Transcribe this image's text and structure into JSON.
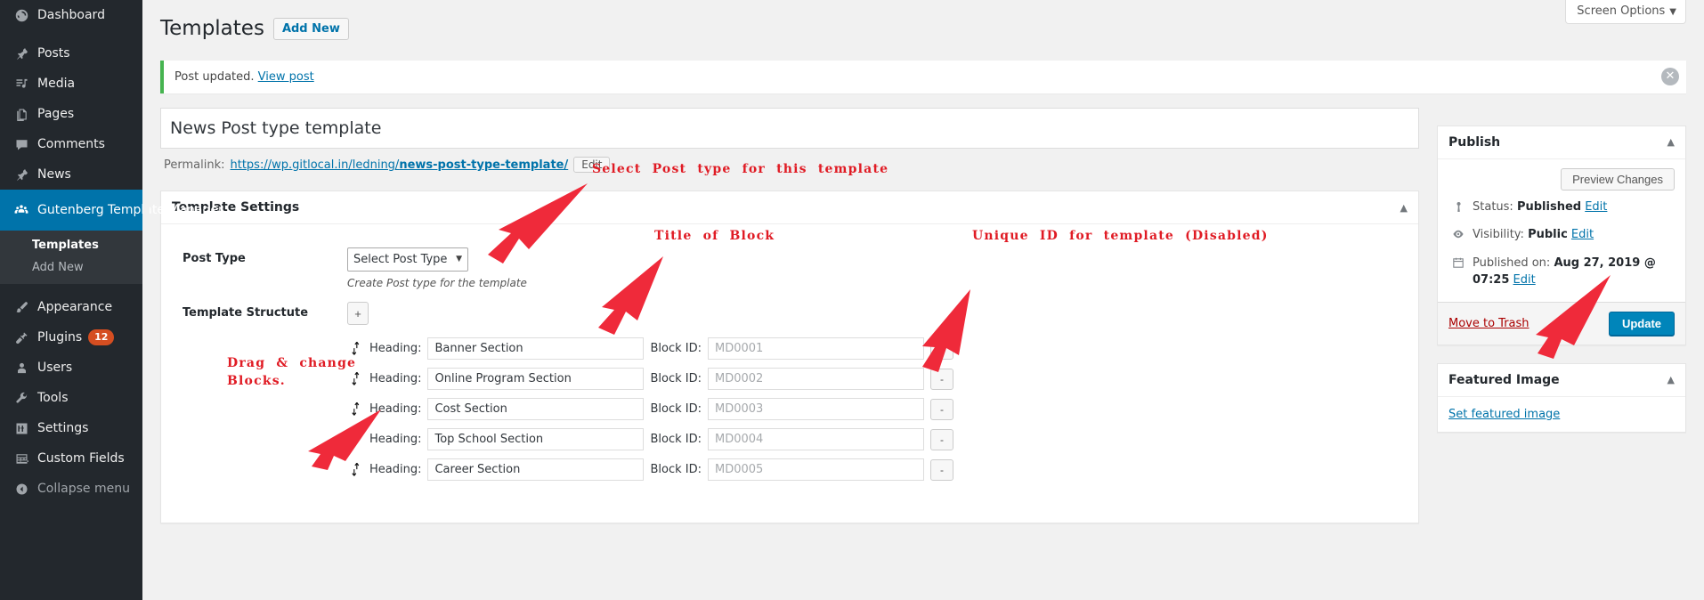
{
  "sidebar": {
    "items": [
      {
        "label": "Dashboard",
        "icon": "dashboard-icon",
        "glyph": "◕"
      },
      {
        "label": "Posts",
        "icon": "pin-icon",
        "glyph": "✎"
      },
      {
        "label": "Media",
        "icon": "media-icon",
        "glyph": "♫"
      },
      {
        "label": "Pages",
        "icon": "page-icon",
        "glyph": "❏"
      },
      {
        "label": "Comments",
        "icon": "comment-icon",
        "glyph": "💬"
      },
      {
        "label": "News",
        "icon": "pin-icon",
        "glyph": "✎"
      }
    ],
    "current": {
      "label": "Gutenberg Template Manager",
      "icon": "users-group-icon",
      "glyph": "👥"
    },
    "submenu": [
      {
        "label": "Templates",
        "active": true
      },
      {
        "label": "Add New",
        "active": false
      }
    ],
    "items_lower": [
      {
        "label": "Appearance",
        "icon": "brush-icon",
        "glyph": "✄"
      },
      {
        "label": "Plugins",
        "icon": "plug-icon",
        "glyph": "⚡",
        "badge": "12"
      },
      {
        "label": "Users",
        "icon": "user-icon",
        "glyph": "👤"
      },
      {
        "label": "Tools",
        "icon": "wrench-icon",
        "glyph": "🔧"
      },
      {
        "label": "Settings",
        "icon": "sliders-icon",
        "glyph": "⇅"
      },
      {
        "label": "Custom Fields",
        "icon": "grid-icon",
        "glyph": "▤"
      }
    ],
    "collapse": {
      "label": "Collapse menu",
      "icon": "collapse-arrow-icon",
      "glyph": "◀"
    }
  },
  "header": {
    "screen_options": "Screen Options",
    "screen_options_caret": "▼",
    "page_title": "Templates",
    "add_new": "Add New"
  },
  "notice": {
    "message": "Post updated.",
    "link": "View post",
    "dismiss_icon": "✕"
  },
  "post": {
    "title": "News Post type template",
    "permalink_label": "Permalink:",
    "permalink_base": "https://wp.gitlocal.in/ledning/",
    "permalink_slug": "news-post-type-template/",
    "edit_button": "Edit"
  },
  "template_settings": {
    "box_title": "Template Settings",
    "toggle_icon": "▲",
    "post_type_label": "Post Type",
    "post_type_value": "Select Post Type",
    "post_type_caret": "▼",
    "post_type_desc": "Create Post type for the template",
    "structure_label": "Template Structute",
    "add_block_button": "+",
    "heading_label": "Heading:",
    "block_id_label": "Block ID:",
    "remove_button": "-",
    "rows": [
      {
        "heading": "Banner Section",
        "block_id_placeholder": "MD0001"
      },
      {
        "heading": "Online Program Section",
        "block_id_placeholder": "MD0002"
      },
      {
        "heading": "Cost Section",
        "block_id_placeholder": "MD0003"
      },
      {
        "heading": "Top School Section",
        "block_id_placeholder": "MD0004"
      },
      {
        "heading": "Career Section",
        "block_id_placeholder": "MD0005"
      }
    ]
  },
  "publish": {
    "box_title": "Publish",
    "toggle_icon": "▲",
    "preview_changes": "Preview Changes",
    "status_label": "Status:",
    "status_value": "Published",
    "status_edit": "Edit",
    "visibility_label": "Visibility:",
    "visibility_value": "Public",
    "visibility_edit": "Edit",
    "published_label": "Published on:",
    "published_value": "Aug 27, 2019 @ 07:25",
    "published_edit": "Edit",
    "move_to_trash": "Move to Trash",
    "update_button": "Update",
    "status_icon": "pin-icon",
    "visibility_icon": "eye-icon",
    "date_icon": "calendar-icon"
  },
  "featured_image": {
    "box_title": "Featured Image",
    "toggle_icon": "▲",
    "set_link": "Set featured image"
  },
  "annotations": {
    "color": "#e01b24",
    "select_post_type": "Select  Post  type  for  this  template",
    "title_of_block": "Title  of  Block",
    "unique_id": "Unique  ID  for  template  (Disabled)",
    "drag_change": "Drag  &  change\nBlocks."
  }
}
